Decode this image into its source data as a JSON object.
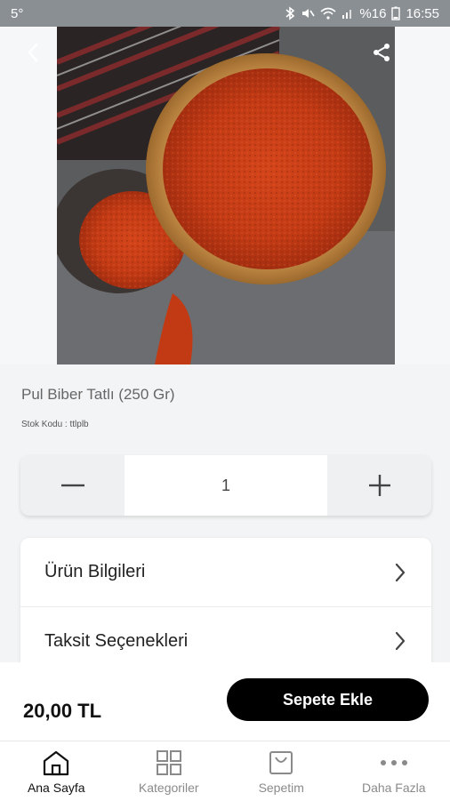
{
  "status_bar": {
    "left_text": "5°",
    "battery_text": "%16",
    "time": "16:55"
  },
  "product": {
    "title": "Pul Biber Tatlı (250 Gr)",
    "stock_label": "Stok Kodu :",
    "stock_code": "ttlplb"
  },
  "quantity": {
    "value": "1"
  },
  "info_rows": [
    {
      "label": "Ürün Bilgileri"
    },
    {
      "label": "Taksit Seçenekleri"
    }
  ],
  "buy_bar": {
    "price": "20,00 TL",
    "add_to_cart_label": "Sepete Ekle"
  },
  "tabs": [
    {
      "label": "Ana Sayfa",
      "icon": "home-icon",
      "active": true
    },
    {
      "label": "Kategoriler",
      "icon": "grid-icon",
      "active": false
    },
    {
      "label": "Sepetim",
      "icon": "shopping-bag-icon",
      "active": false
    },
    {
      "label": "Daha Fazla",
      "icon": "more-dots-icon",
      "active": false
    }
  ]
}
